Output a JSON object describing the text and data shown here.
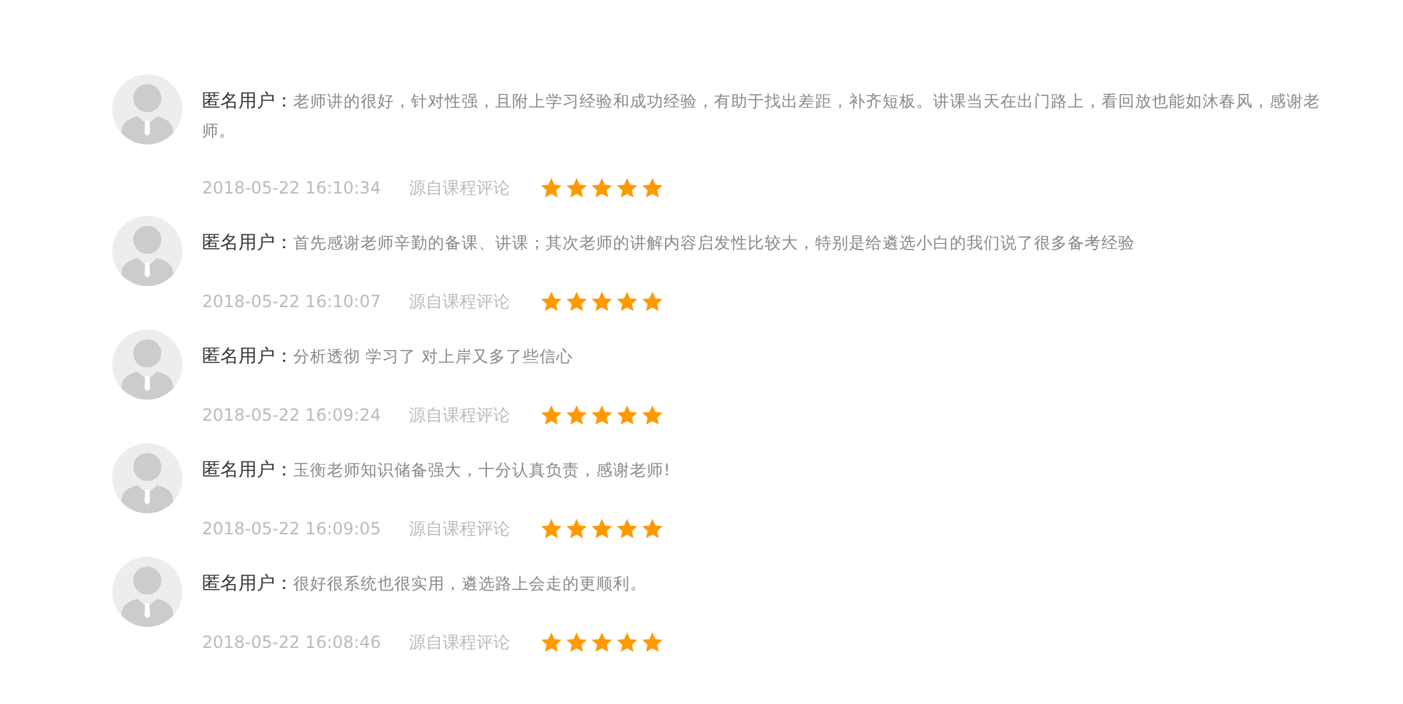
{
  "reviews": [
    {
      "user": "匿名用户：",
      "comment": "老师讲的很好，针对性强，且附上学习经验和成功经验，有助于找出差距，补齐短板。讲课当天在出门路上，看回放也能如沐春风，感谢老师。",
      "time": "2018-05-22 16:10:34",
      "source": "源自课程评论",
      "stars": 5
    },
    {
      "user": "匿名用户：",
      "comment": "首先感谢老师辛勤的备课、讲课；其次老师的讲解内容启发性比较大，特别是给遴选小白的我们说了很多备考经验",
      "time": "2018-05-22 16:10:07",
      "source": "源自课程评论",
      "stars": 5
    },
    {
      "user": "匿名用户：",
      "comment": "分析透彻 学习了 对上岸又多了些信心",
      "time": "2018-05-22 16:09:24",
      "source": "源自课程评论",
      "stars": 5
    },
    {
      "user": "匿名用户：",
      "comment": "玉衡老师知识储备强大，十分认真负责，感谢老师!",
      "time": "2018-05-22 16:09:05",
      "source": "源自课程评论",
      "stars": 5
    },
    {
      "user": "匿名用户：",
      "comment": "很好很系统也很实用，遴选路上会走的更顺利。",
      "time": "2018-05-22 16:08:46",
      "source": "源自课程评论",
      "stars": 5
    }
  ]
}
